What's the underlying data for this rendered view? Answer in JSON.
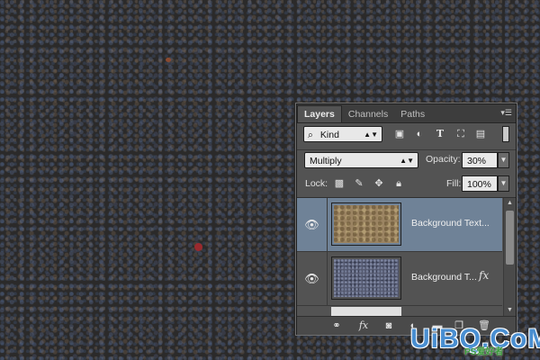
{
  "panel": {
    "tabs": [
      {
        "label": "Layers",
        "active": true
      },
      {
        "label": "Channels",
        "active": false
      },
      {
        "label": "Paths",
        "active": false
      }
    ],
    "menu_icon": "panel-menu-icon"
  },
  "filter": {
    "kind_label": "Kind",
    "icons": [
      "pixel-filter-icon",
      "adjustment-filter-icon",
      "type-filter-icon",
      "shape-filter-icon",
      "smart-object-filter-icon"
    ]
  },
  "blend": {
    "mode": "Multiply",
    "opacity_label": "Opacity:",
    "opacity_value": "30%"
  },
  "lock": {
    "label": "Lock:",
    "icons": [
      "lock-transparent-icon",
      "lock-pixels-icon",
      "lock-position-icon",
      "lock-all-icon"
    ],
    "fill_label": "Fill:",
    "fill_value": "100%"
  },
  "layers": [
    {
      "name": "Background Text...",
      "visible": true,
      "selected": true,
      "has_fx": false
    },
    {
      "name": "Background T...",
      "visible": true,
      "selected": false,
      "has_fx": true,
      "fx_label": "fx"
    }
  ],
  "bottom_icons": [
    "link-layers-icon",
    "add-style-icon",
    "add-mask-icon",
    "new-adjustment-icon",
    "new-group-icon",
    "new-layer-icon",
    "delete-layer-icon"
  ],
  "bottom_fx_label": "fx",
  "watermark": {
    "text": "UiBQ.CoM",
    "sub": "PS爱好者"
  },
  "colors": {
    "panel_bg": "#535353",
    "selected_layer": "#6f8297",
    "canvas_bg": "#2b2a2a",
    "watermark": "#4a8fd1"
  }
}
